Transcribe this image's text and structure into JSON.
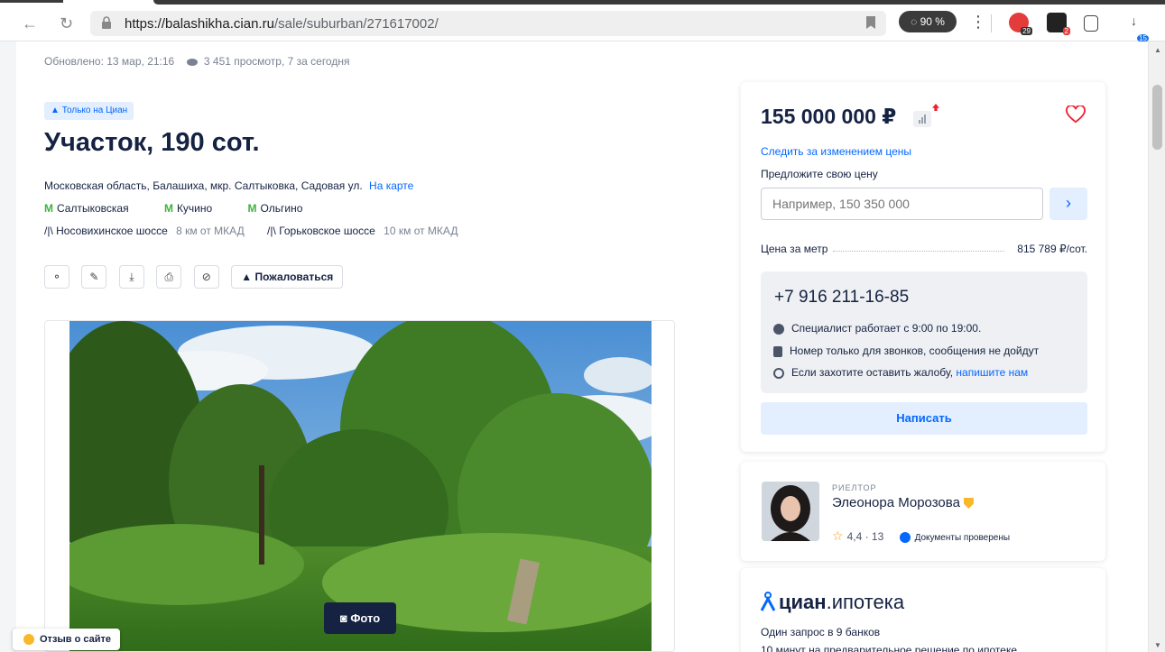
{
  "browser": {
    "url_host": "https://balashikha.cian.ru",
    "url_path": "/sale/suburban/271617002/",
    "zoom_badge": "90 %",
    "ext_badges": [
      "29",
      "2",
      "15"
    ]
  },
  "listing": {
    "updated": "Обновлено: 13 мар, 21:16",
    "views": "3 451 просмотр, 7 за сегодня",
    "only_cian": "Только на Циан",
    "title": "Участок, 190 сот.",
    "address": "Московская область, Балашиха, мкр. Салтыковка, Садовая ул.",
    "map_link": "На карте",
    "metro": [
      "Салтыковская",
      "Кучино",
      "Ольгино"
    ],
    "highways": [
      {
        "name": "Носовихинское шоссе",
        "distance": "8 км от МКАД"
      },
      {
        "name": "Горьковское шоссе",
        "distance": "10 км от МКАД"
      }
    ],
    "report_label": "Пожаловаться",
    "photo_button": "Фото"
  },
  "review_label": "Отзыв о сайте",
  "price_card": {
    "price": "155 000 000 ₽",
    "follow_price": "Следить за изменением цены",
    "offer_label": "Предложите свою цену",
    "offer_placeholder": "Например, 150 350 000",
    "ppm_label": "Цена за метр",
    "ppm_value": "815 789 ₽/сот.",
    "phone": "+7 916 211-16-85",
    "hours": "Специалист работает с 9:00 по 19:00.",
    "calls_only": "Номер только для звонков, сообщения не дойдут",
    "complaint_text": "Если захотите оставить жалобу,",
    "complaint_link": "напишите нам",
    "write_button": "Написать"
  },
  "agent": {
    "role": "РИЕЛТОР",
    "name": "Элеонора Морозова",
    "rating": "4,4 · 13",
    "docs": "Документы проверены"
  },
  "mortgage": {
    "brand_bold": "циан",
    "brand_rest": ".ипотека",
    "line1": "Один запрос в 9 банков",
    "line2": "10 минут на предварительное решение по ипотеке"
  },
  "colors": {
    "accent": "#0468ff",
    "text": "#152242",
    "metro": "#3db33b",
    "danger": "#ee1f2f"
  }
}
